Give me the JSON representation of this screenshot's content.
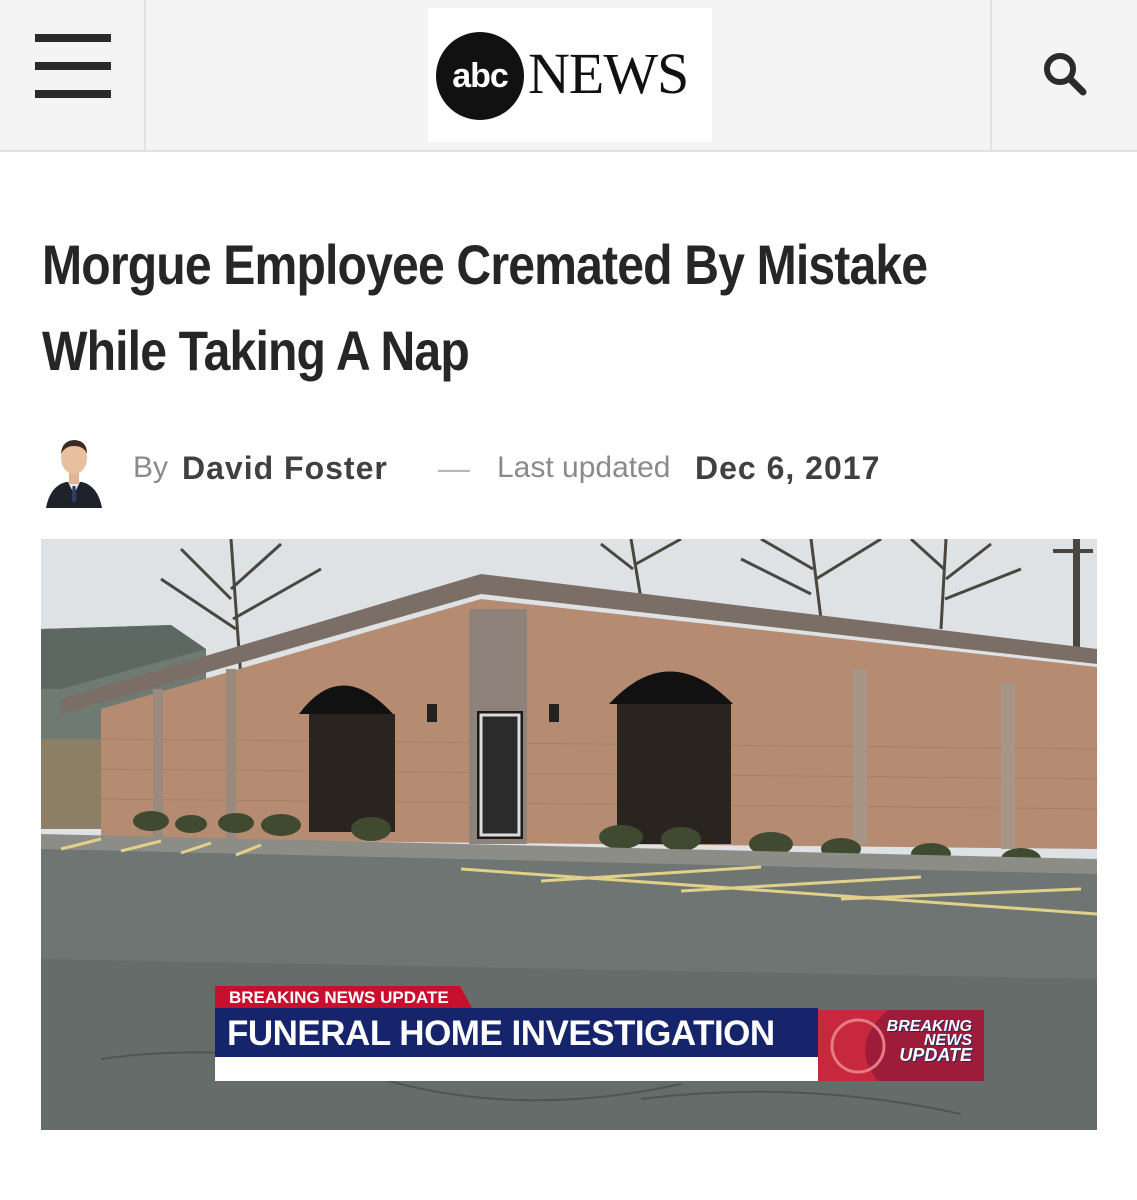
{
  "header": {
    "logo_mark": "abc",
    "logo_word": "NEWS",
    "menu_icon": "hamburger-menu-icon",
    "search_icon": "search-icon"
  },
  "article": {
    "headline_line1": "Morgue Employee Cremated By Mistake",
    "headline_line2": "While Taking A Nap",
    "by_prefix": "By",
    "author": "David Foster",
    "separator": "—",
    "updated_label": "Last updated",
    "date": "Dec 6, 2017"
  },
  "hero": {
    "tag": "BREAKING NEWS UPDATE",
    "caption": "FUNERAL HOME INVESTIGATION",
    "badge_line1": "BREAKING",
    "badge_line2": "NEWS",
    "badge_line3": "UPDATE"
  },
  "colors": {
    "text": "#262626",
    "muted": "#8a8a8a",
    "header_bg": "#f4f4f4",
    "tag_red": "#c8102e",
    "caption_navy": "#15246b"
  }
}
